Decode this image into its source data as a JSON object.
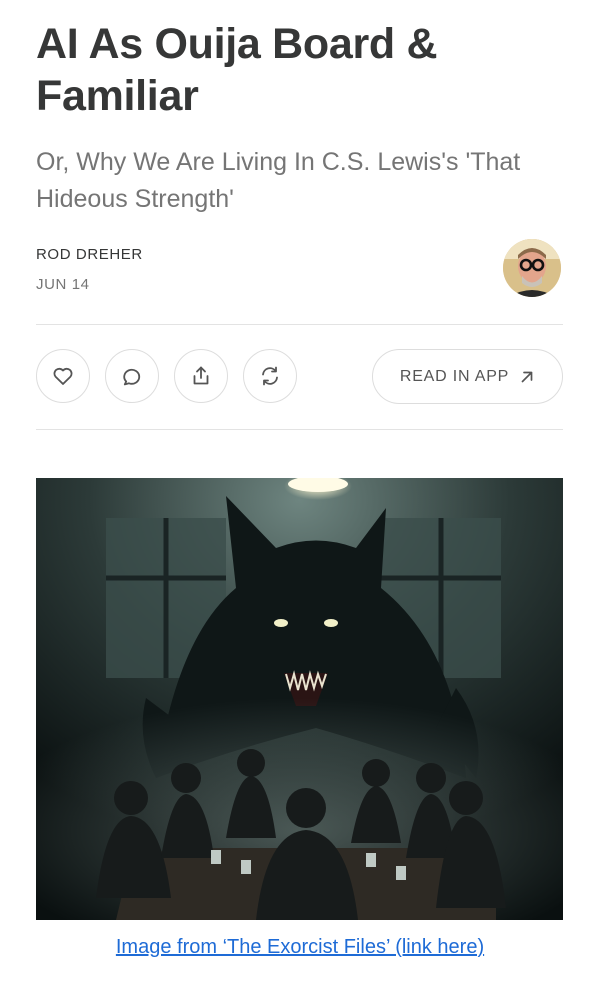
{
  "article": {
    "title": "AI As Ouija Board & Familiar",
    "subtitle": "Or, Why We Are Living In C.S. Lewis's 'That Hideous Strength'",
    "author": "ROD DREHER",
    "date": "JUN 14"
  },
  "actions": {
    "like_icon": "heart-icon",
    "comment_icon": "comment-icon",
    "share_icon": "share-icon",
    "restack_icon": "restack-icon",
    "read_in_app_label": "READ IN APP",
    "read_in_app_icon": "arrow-up-right-icon"
  },
  "image": {
    "caption": "Image from ‘The Exorcist Files’ (link here)"
  },
  "colors": {
    "title": "#363737",
    "subtitle": "#757575",
    "link": "#1e6bd6",
    "border": "#dddddd"
  }
}
